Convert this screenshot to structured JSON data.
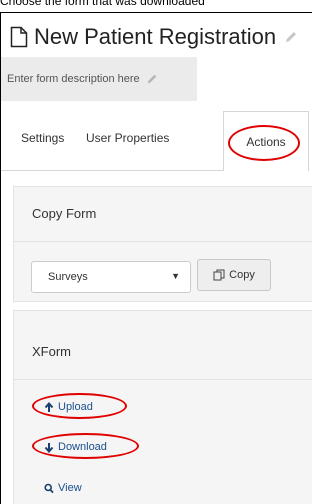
{
  "caption": "Choose the form that was downloaded",
  "form": {
    "title": "New Patient Registration",
    "description_placeholder": "Enter form description here"
  },
  "tabs": [
    {
      "label": "Settings"
    },
    {
      "label": "User Properties"
    },
    {
      "label": "Actions",
      "active": true
    }
  ],
  "copy_form": {
    "heading": "Copy Form",
    "select_value": "Surveys",
    "copy_button": "Copy"
  },
  "xform": {
    "heading": "XForm",
    "upload": "Upload",
    "download": "Download",
    "view": "View"
  },
  "colors": {
    "highlight": "#e00000",
    "link": "#1a4f8f",
    "panel_bg": "#f5f5f5"
  },
  "icons": [
    "file-icon",
    "pencil-icon",
    "copy-icon",
    "arrow-up-icon",
    "arrow-down-icon",
    "search-icon",
    "caret-down-icon"
  ]
}
